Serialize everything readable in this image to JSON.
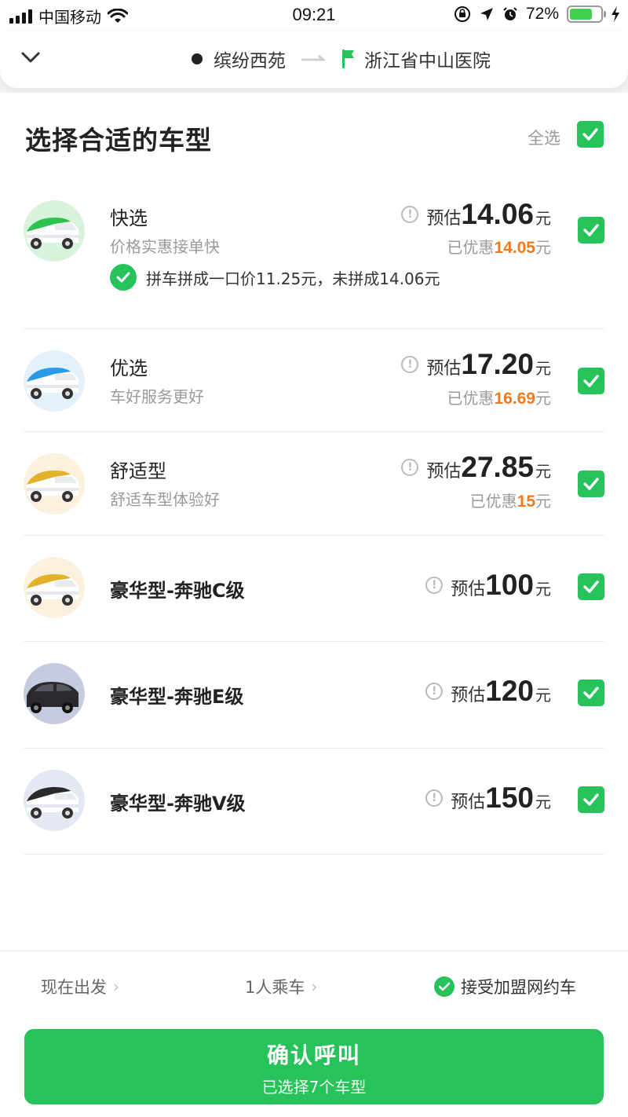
{
  "status_bar": {
    "carrier": "中国移动",
    "time": "09:21",
    "battery": "72%",
    "battery_level": 0.72
  },
  "route": {
    "from": "缤纷西苑",
    "to": "浙江省中山医院"
  },
  "section": {
    "title": "选择合适的车型",
    "select_all": "全选"
  },
  "car_types": [
    {
      "name": "快选",
      "desc": "价格实惠接单快",
      "est_label": "预估",
      "price": "14.06",
      "unit": "元",
      "disc_label": "已优惠",
      "disc": "14.05",
      "disc_unit": "元",
      "accent": "#2cc34f",
      "carpool": "拼车拼成一口价11.25元，未拼成14.06元",
      "selected": true
    },
    {
      "name": "优选",
      "desc": "车好服务更好",
      "est_label": "预估",
      "price": "17.20",
      "unit": "元",
      "disc_label": "已优惠",
      "disc": "16.69",
      "disc_unit": "元",
      "accent": "#2b9be8",
      "selected": true
    },
    {
      "name": "舒适型",
      "desc": "舒适车型体验好",
      "est_label": "预估",
      "price": "27.85",
      "unit": "元",
      "disc_label": "已优惠",
      "disc": "15",
      "disc_unit": "元",
      "accent": "#e4b12a",
      "selected": true
    },
    {
      "name": "豪华型-奔驰C级",
      "est_label": "预估",
      "price": "100",
      "unit": "元",
      "accent": "#e4b12a",
      "selected": true
    },
    {
      "name": "豪华型-奔驰E级",
      "est_label": "预估",
      "price": "120",
      "unit": "元",
      "accent": "#2a2a2e",
      "selected": true
    },
    {
      "name": "豪华型-奔驰V级",
      "est_label": "预估",
      "price": "150",
      "unit": "元",
      "accent": "#2a2a2e",
      "selected": true
    }
  ],
  "options": {
    "depart": "现在出发",
    "passengers": "1人乘车",
    "accept": "接受加盟网约车"
  },
  "confirm": {
    "label": "确认呼叫",
    "sub": "已选择7个车型"
  },
  "colors": {
    "brand_green": "#27c25a",
    "discount_orange": "#f07a20"
  }
}
